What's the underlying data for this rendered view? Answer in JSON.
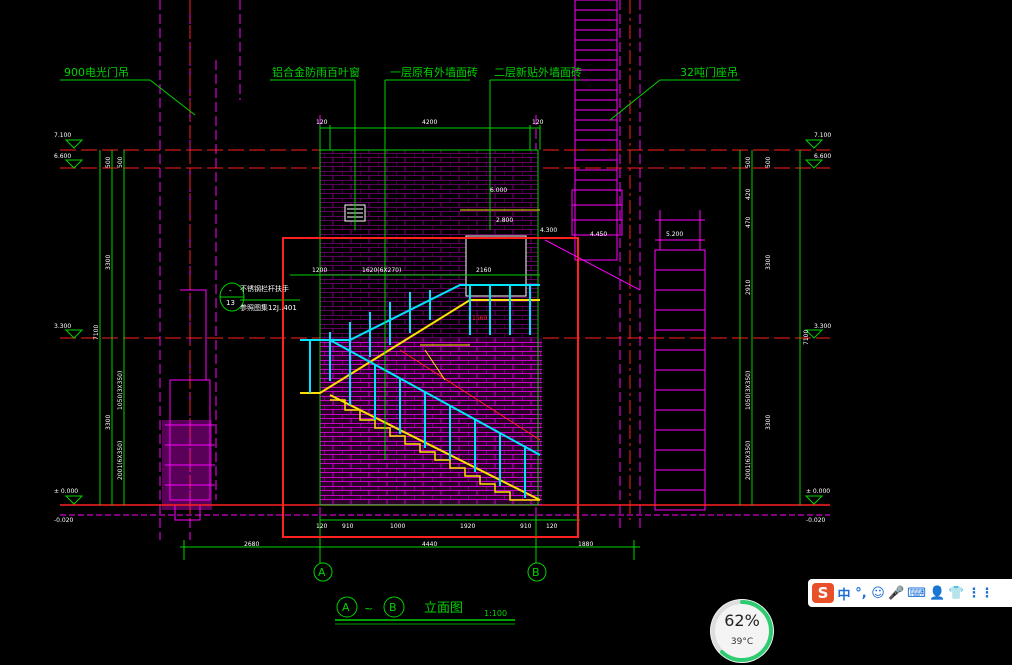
{
  "drawing": {
    "labels": {
      "door_900": "900电光门吊",
      "louver": "铝合金防雨百叶窗",
      "wall_1f": "一层原有外墙面砖",
      "wall_2f": "二层新贴外墙面砖",
      "door_32": "32吨门座吊",
      "handrail_note_1": "不锈钢栏杆扶手",
      "handrail_note_2": "参照图集12J..401",
      "callout_top": "-",
      "callout_num": "13"
    },
    "dims": {
      "top_120_l": "120",
      "top_4200": "4200",
      "top_120_r": "120",
      "lv_7100": "7.100",
      "lv_6600": "6.600",
      "lv_3300": "3.300",
      "lv_0000": "± 0.000",
      "lv_m0020": "-0.020",
      "rv_7100": "7.100",
      "rv_6600": "6.600",
      "rv_3300": "3.300",
      "rv_0000": "± 0.000",
      "rv_m0020": "-0.020",
      "lv_500a": "500",
      "lv_500b": "500",
      "lv_3300v": "3300",
      "lv_3300v2": "3300",
      "lv_1050": "1050(3X350)",
      "lv_2001": "2001(6X350)",
      "lv_7100v": "7100",
      "rv_500a": "500",
      "rv_500b": "500",
      "rv_3300v": "3300",
      "rv_3300v2": "3300",
      "rv_1050": "1050(3X350)",
      "rv_2001": "2001(6X350)",
      "rv_7100v": "7100",
      "r_420": "420",
      "r_470": "470",
      "r_2910": "2910",
      "mid_6000": "6.000",
      "mid_2800": "2.800",
      "mid_4300": "4.300",
      "mid_4450": "4.450",
      "mid_5200": "5.200",
      "stair_1200": "1200",
      "stair_1620": "1620(6X270)",
      "stair_2160": "2160",
      "stair_1560": "1560",
      "bot_120a": "120",
      "bot_910": "910",
      "bot_1000": "1000",
      "bot_1920": "1920",
      "bot_910b": "910",
      "bot_120b": "120",
      "b2_2680": "2680",
      "b2_4440": "4440",
      "b2_1880": "1880"
    },
    "axes": {
      "a": "A",
      "b": "B"
    },
    "title": {
      "a": "A",
      "sep": "~",
      "b": "B",
      "text": "立面图",
      "scale": "1:100"
    }
  },
  "ime": {
    "logo": "S",
    "items": [
      "中",
      "°,",
      "☺",
      "🎤",
      "⌨",
      "👤",
      "👕",
      "⋮⋮"
    ]
  },
  "monitor": {
    "percent": "62%",
    "percent_value": 62,
    "temp": "39°C"
  },
  "colors": {
    "green": "#00d200",
    "red": "#ff2020",
    "magenta": "#ff00ff",
    "cyan": "#00e5ff",
    "yellow": "#ffe000",
    "brick": "#ff00ff"
  }
}
